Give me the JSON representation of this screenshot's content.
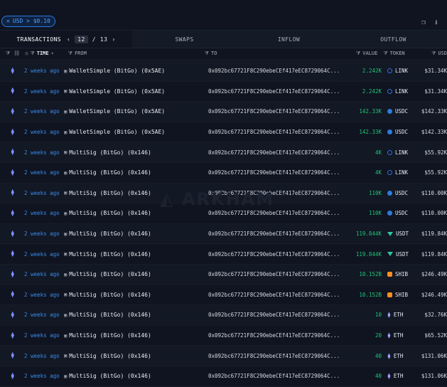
{
  "filter_chip": {
    "text": "USD > $0.10"
  },
  "tabs": {
    "transactions": "TRANSACTIONS",
    "page_current": "12",
    "page_sep": "/",
    "page_total": "13",
    "swaps": "SWAPS",
    "inflow": "INFLOW",
    "outflow": "OUTFLOW"
  },
  "columns": {
    "time": "TIME",
    "from": "FROM",
    "to": "TO",
    "value": "VALUE",
    "token": "TOKEN",
    "usd": "USD"
  },
  "rows": [
    {
      "time": "2 weeks ago",
      "from": "WalletSimple (BitGo) (0x5AE)",
      "to": "0x092bc67721F8C290ebeCEf417eEC8729064C...",
      "value": "2.242K",
      "token": "LINK",
      "token_icon": "link-icon",
      "usd": "$31.34K"
    },
    {
      "time": "2 weeks ago",
      "from": "WalletSimple (BitGo) (0x5AE)",
      "to": "0x092bc67721F8C290ebeCEf417eEC8729064C...",
      "value": "2.242K",
      "token": "LINK",
      "token_icon": "link-icon",
      "usd": "$31.34K"
    },
    {
      "time": "2 weeks ago",
      "from": "WalletSimple (BitGo) (0x5AE)",
      "to": "0x092bc67721F8C290ebeCEf417eEC8729064C...",
      "value": "142.33K",
      "token": "USDC",
      "token_icon": "usdc-icon",
      "usd": "$142.33K"
    },
    {
      "time": "2 weeks ago",
      "from": "WalletSimple (BitGo) (0x5AE)",
      "to": "0x092bc67721F8C290ebeCEf417eEC8729064C...",
      "value": "142.33K",
      "token": "USDC",
      "token_icon": "usdc-icon",
      "usd": "$142.33K"
    },
    {
      "time": "2 weeks ago",
      "from": "MultiSig (BitGo) (0x146)",
      "to": "0x092bc67721F8C290ebeCEf417eEC8729064C...",
      "value": "4K",
      "token": "LINK",
      "token_icon": "link-icon",
      "usd": "$55.92K"
    },
    {
      "time": "2 weeks ago",
      "from": "MultiSig (BitGo) (0x146)",
      "to": "0x092bc67721F8C290ebeCEf417eEC8729064C...",
      "value": "4K",
      "token": "LINK",
      "token_icon": "link-icon",
      "usd": "$55.92K"
    },
    {
      "time": "2 weeks ago",
      "from": "MultiSig (BitGo) (0x146)",
      "to": "0x092bc67721F8C290ebeCEf417eEC8729064C...",
      "value": "110K",
      "token": "USDC",
      "token_icon": "usdc-icon",
      "usd": "$110.00K"
    },
    {
      "time": "2 weeks ago",
      "from": "MultiSig (BitGo) (0x146)",
      "to": "0x092bc67721F8C290ebeCEf417eEC8729064C...",
      "value": "110K",
      "token": "USDC",
      "token_icon": "usdc-icon",
      "usd": "$110.00K"
    },
    {
      "time": "2 weeks ago",
      "from": "MultiSig (BitGo) (0x146)",
      "to": "0x092bc67721F8C290ebeCEf417eEC8729064C...",
      "value": "119.844K",
      "token": "USDT",
      "token_icon": "usdt-icon",
      "usd": "$119.84K"
    },
    {
      "time": "2 weeks ago",
      "from": "MultiSig (BitGo) (0x146)",
      "to": "0x092bc67721F8C290ebeCEf417eEC8729064C...",
      "value": "119.844K",
      "token": "USDT",
      "token_icon": "usdt-icon",
      "usd": "$119.84K"
    },
    {
      "time": "2 weeks ago",
      "from": "MultiSig (BitGo) (0x146)",
      "to": "0x092bc67721F8C290ebeCEf417eEC8729064C...",
      "value": "10.152B",
      "token": "SHIB",
      "token_icon": "shib-icon",
      "usd": "$246.49K"
    },
    {
      "time": "2 weeks ago",
      "from": "MultiSig (BitGo) (0x146)",
      "to": "0x092bc67721F8C290ebeCEf417eEC8729064C...",
      "value": "10.152B",
      "token": "SHIB",
      "token_icon": "shib-icon",
      "usd": "$246.49K"
    },
    {
      "time": "2 weeks ago",
      "from": "MultiSig (BitGo) (0x146)",
      "to": "0x092bc67721F8C290ebeCEf417eEC8729064C...",
      "value": "10",
      "token": "ETH",
      "token_icon": "eth-icon",
      "usd": "$32.76K"
    },
    {
      "time": "2 weeks ago",
      "from": "MultiSig (BitGo) (0x146)",
      "to": "0x092bc67721F8C290ebeCEf417eEC8729064C...",
      "value": "20",
      "token": "ETH",
      "token_icon": "eth-icon",
      "usd": "$65.52K"
    },
    {
      "time": "2 weeks ago",
      "from": "MultiSig (BitGo) (0x146)",
      "to": "0x092bc67721F8C290ebeCEf417eEC8729064C...",
      "value": "40",
      "token": "ETH",
      "token_icon": "eth-icon",
      "usd": "$131.06K"
    },
    {
      "time": "2 weeks ago",
      "from": "MultiSig (BitGo) (0x146)",
      "to": "0x092bc67721F8C290ebeCEf417eEC8729064C...",
      "value": "40",
      "token": "ETH",
      "token_icon": "eth-icon",
      "usd": "$131.06K"
    }
  ],
  "colors": {
    "accent": "#2b7be4",
    "positive_value": "#23c277",
    "time_link": "#3d8ae6",
    "background": "#0f1420"
  }
}
